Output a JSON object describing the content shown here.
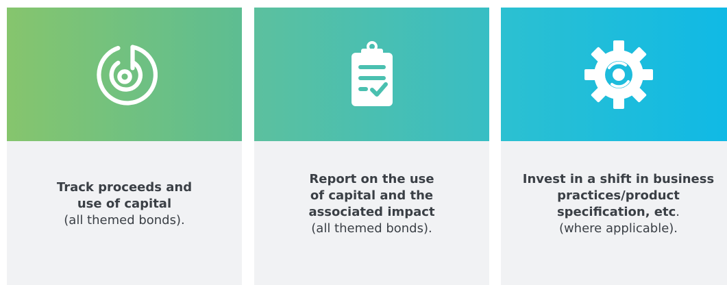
{
  "cards": [
    {
      "icon": "radar-target-icon",
      "title_lines": [
        "Track proceeds and",
        "use of capital"
      ],
      "note": "(all themed bonds)."
    },
    {
      "icon": "clipboard-checklist-icon",
      "title_lines": [
        "Report on the use",
        "of capital and the",
        "associated impact"
      ],
      "note": "(all themed bonds)."
    },
    {
      "icon": "gear-icon",
      "title_lines": [
        "Invest in a shift in business",
        "practices/product",
        "specification, etc"
      ],
      "title_suffix": ".",
      "note": "(where applicable)."
    }
  ],
  "colors": {
    "card_bg": "#f1f2f4",
    "text": "#3a3f45",
    "card1_gradient": [
      "#86c56d",
      "#5dbd92"
    ],
    "card2_gradient": [
      "#5cc09e",
      "#38bec4"
    ],
    "card3_gradient": [
      "#2cc0d1",
      "#0fb9e6"
    ]
  }
}
